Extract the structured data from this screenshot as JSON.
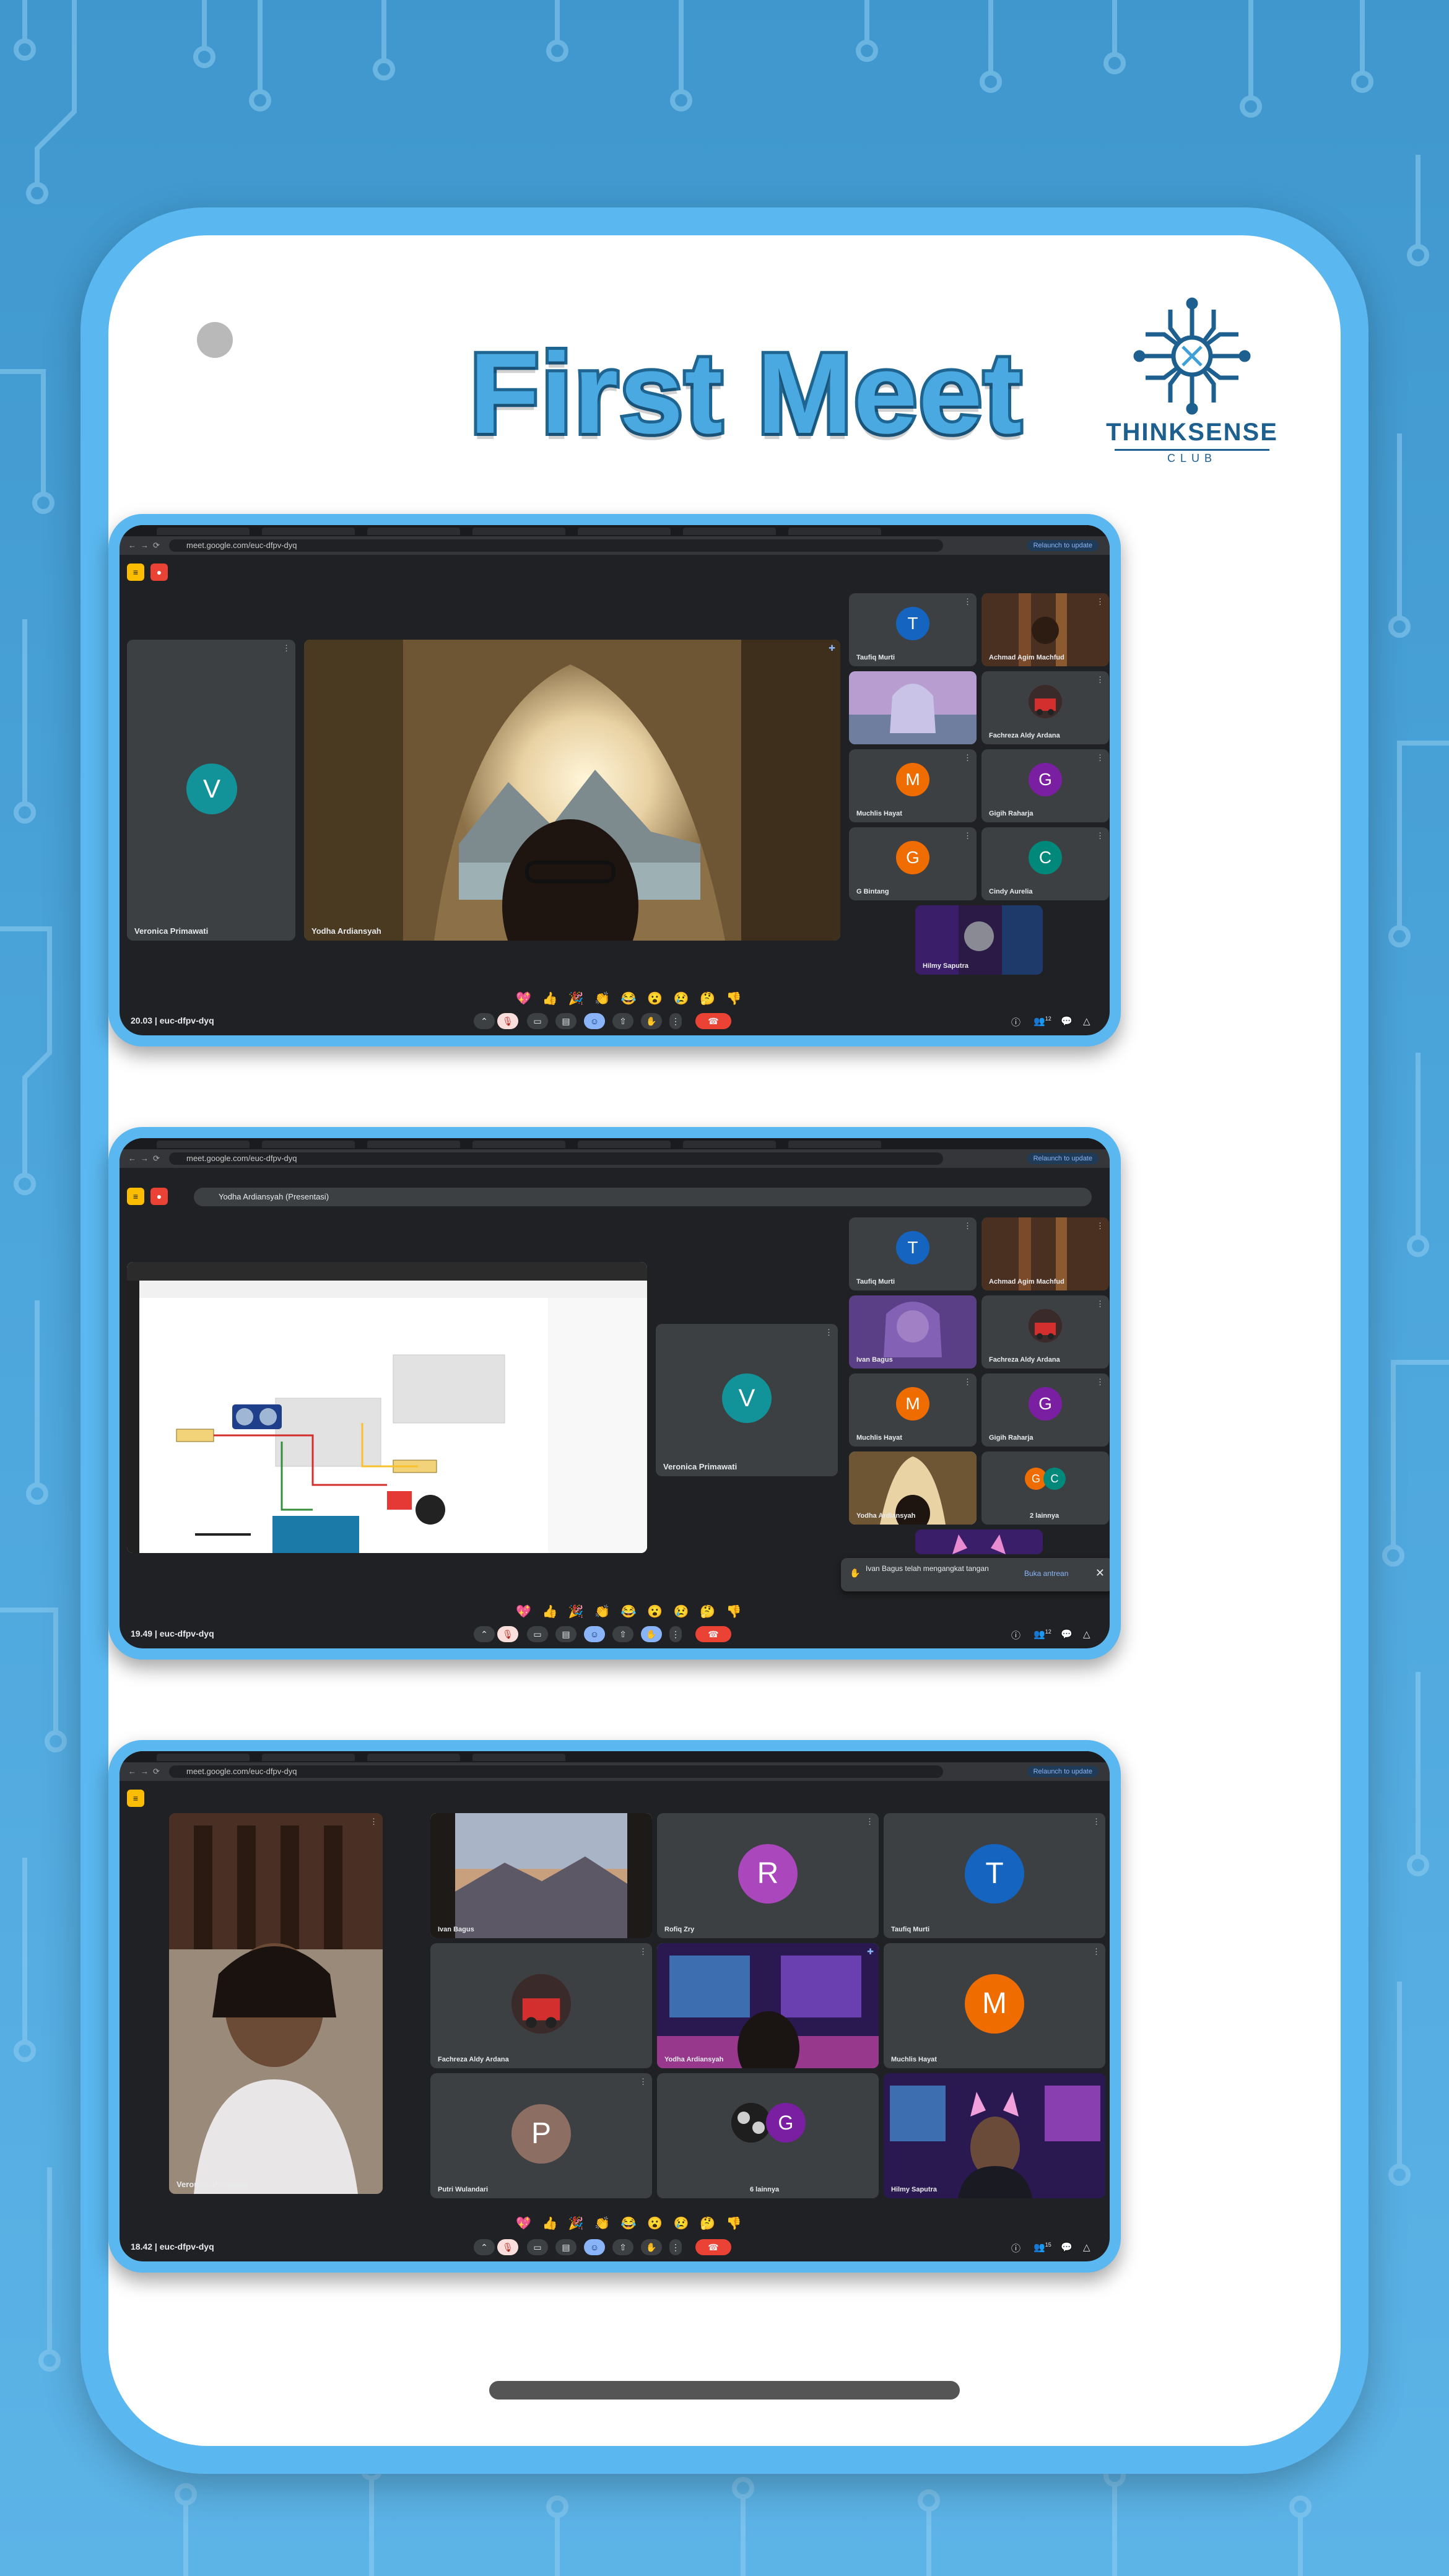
{
  "poster": {
    "title": "First Meet",
    "logo_text": "THINKSENSE",
    "logo_sub": "CLUB"
  },
  "colors": {
    "background": "#4da6dc",
    "frame": "#5ab7ef",
    "title_fill": "#4aa9e0",
    "title_stroke": "#1f6591",
    "meet_dark": "#202124",
    "tile": "#3c4043",
    "hangup": "#ea4335"
  },
  "icons": {
    "more": "more-vert-icon",
    "pin": "pin-icon",
    "hangup": "call-end-icon",
    "mic_off": "mic-off-icon",
    "hand": "raise-hand-icon"
  },
  "browser": {
    "url": "meet.google.com/euc-dfpv-dyq",
    "relaunch": "Relaunch to update"
  },
  "meeting_code": "euc-dfpv-dyq",
  "reactions": "💖 👍 🎉 👏 😂 😮 😢 🤔 👎",
  "shot1": {
    "time": "20.03",
    "participant_count": "12",
    "left_tile": {
      "name": "Veronica Primawati",
      "initial": "V"
    },
    "main_tile": {
      "name": "Yodha Ardiansyah"
    },
    "side": [
      {
        "name": "Taufiq Murti",
        "initial": "T"
      },
      {
        "name": "Achmad Agim Machfud",
        "initial": ""
      },
      {
        "name": "",
        "initial": ""
      },
      {
        "name": "Fachreza Aldy Ardana",
        "initial": ""
      },
      {
        "name": "Muchlis Hayat",
        "initial": "M"
      },
      {
        "name": "Gigih Raharja",
        "initial": "G"
      },
      {
        "name": "G Bintang",
        "initial": "G"
      },
      {
        "name": "Cindy Aurelia",
        "initial": "C"
      },
      {
        "name": "Hilmy Saputra",
        "initial": ""
      }
    ]
  },
  "shot2": {
    "time": "19.49",
    "participant_count": "12",
    "presenting": "Yodha Ardiansyah (Presentasi)",
    "center_tile": {
      "name": "Veronica Primawati",
      "initial": "V"
    },
    "side": [
      {
        "name": "Taufiq Murti",
        "initial": "T"
      },
      {
        "name": "Achmad Agim Machfud",
        "initial": ""
      },
      {
        "name": "Ivan Bagus",
        "initial": ""
      },
      {
        "name": "Fachreza Aldy Ardana",
        "initial": ""
      },
      {
        "name": "Muchlis Hayat",
        "initial": "M"
      },
      {
        "name": "Gigih Raharja",
        "initial": "G"
      },
      {
        "name": "Yodha Ardiansyah",
        "initial": ""
      },
      {
        "name": "2 lainnya",
        "initial": "G",
        "initial2": "C"
      }
    ],
    "toast": {
      "message": "Ivan Bagus telah mengangkat tangan",
      "action": "Buka antrean"
    }
  },
  "shot3": {
    "time": "18.42",
    "participant_count": "15",
    "left_tile": {
      "name": "Veronica Primawati"
    },
    "grid": [
      {
        "name": "Ivan Bagus",
        "initial": ""
      },
      {
        "name": "Rofiq Zry",
        "initial": "R"
      },
      {
        "name": "Taufiq Murti",
        "initial": "T"
      },
      {
        "name": "Fachreza Aldy Ardana",
        "initial": ""
      },
      {
        "name": "Yodha Ardiansyah",
        "initial": ""
      },
      {
        "name": "Muchlis Hayat",
        "initial": "M"
      },
      {
        "name": "Putri Wulandari",
        "initial": "P"
      },
      {
        "name": "6 lainnya",
        "initial": "G"
      },
      {
        "name": "Hilmy Saputra",
        "initial": ""
      }
    ]
  }
}
